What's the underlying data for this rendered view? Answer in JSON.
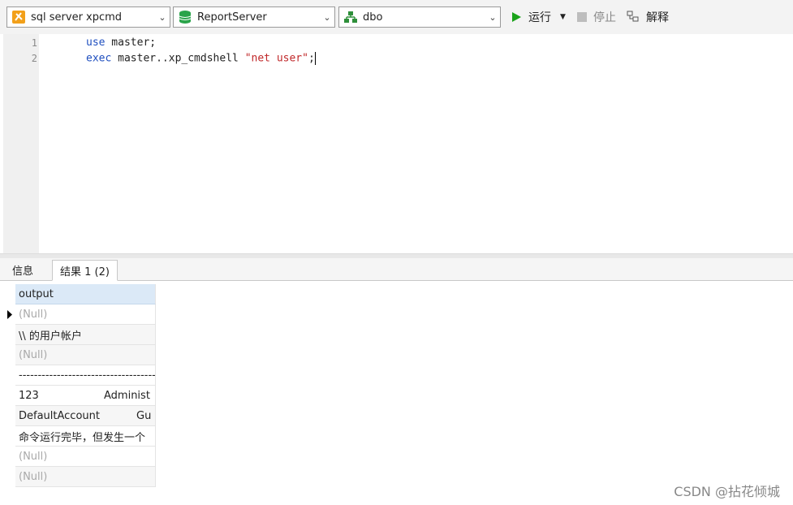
{
  "toolbar": {
    "connection": "sql server xpcmd",
    "database": "ReportServer",
    "schema": "dbo",
    "run_label": "运行",
    "stop_label": "停止",
    "explain_label": "解释",
    "colors": {
      "run": "#1aa31a",
      "connection_icon": "#f2a01a",
      "db_icon": "#2aa44a",
      "schema_icon": "#2e8f3a"
    }
  },
  "editor": {
    "lines": [
      {
        "num": "1",
        "kw": "use",
        "rest": " master;"
      },
      {
        "num": "2",
        "kw": "exec",
        "rest": " master..xp_cmdshell ",
        "str": "\"net user\"",
        "end": ";"
      }
    ]
  },
  "tabs": {
    "info": "信息",
    "result": "结果 1 (2)"
  },
  "grid": {
    "header": "output",
    "rows": [
      {
        "c1": "(Null)",
        "null": true
      },
      {
        "c1": "\\\\ 的用户帐户"
      },
      {
        "c1": "(Null)",
        "null": true
      },
      {
        "c1": "-----------------------------------------"
      },
      {
        "c1": "123",
        "c2": "Administ"
      },
      {
        "c1": "DefaultAccount",
        "c2": "Gu"
      },
      {
        "c1": "命令运行完毕，但发生一个"
      },
      {
        "c1": "(Null)",
        "null": true
      },
      {
        "c1": "(Null)",
        "null": true
      }
    ]
  },
  "watermark": "CSDN @拈花倾城"
}
